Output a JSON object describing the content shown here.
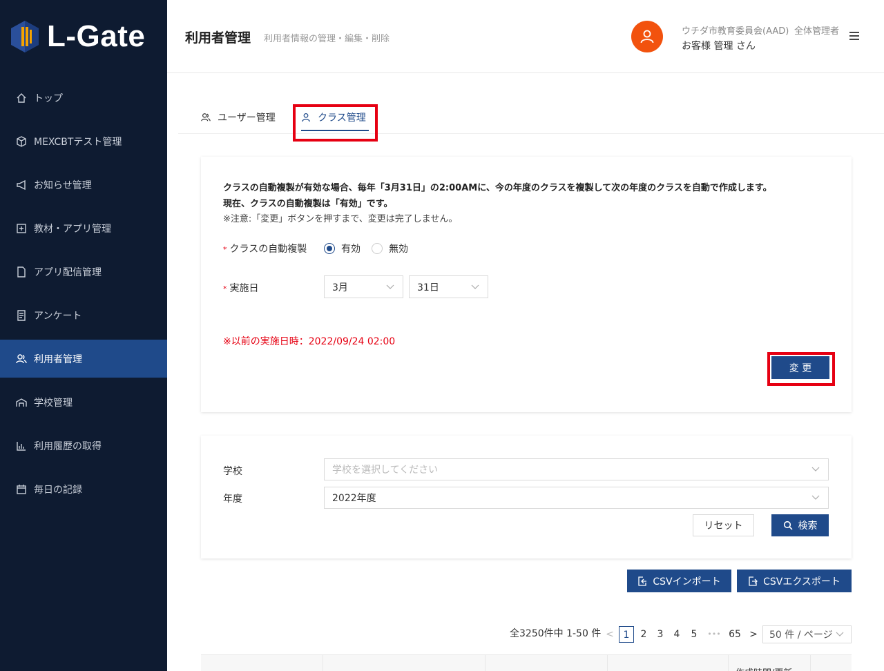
{
  "app": {
    "logo_text": "L-Gate"
  },
  "sidebar": {
    "items": [
      {
        "label": "トップ",
        "icon": "home-icon"
      },
      {
        "label": "MEXCBTテスト管理",
        "icon": "cube-icon"
      },
      {
        "label": "お知らせ管理",
        "icon": "megaphone-icon"
      },
      {
        "label": "教材・アプリ管理",
        "icon": "plus-square-icon"
      },
      {
        "label": "アプリ配信管理",
        "icon": "file-icon"
      },
      {
        "label": "アンケート",
        "icon": "survey-icon"
      },
      {
        "label": "利用者管理",
        "icon": "users-icon",
        "active": true
      },
      {
        "label": "学校管理",
        "icon": "school-icon"
      },
      {
        "label": "利用履歴の取得",
        "icon": "bar-chart-icon"
      },
      {
        "label": "毎日の記録",
        "icon": "calendar-icon"
      }
    ]
  },
  "header": {
    "title": "利用者管理",
    "subtitle": "利用者情報の管理・編集・削除",
    "org": "ウチダ市教育委員会(AAD)",
    "role": "全体管理者",
    "user": "お客様 管理 さん"
  },
  "tabs": [
    {
      "label": "ユーザー管理",
      "icon": "users-icon"
    },
    {
      "label": "クラス管理",
      "icon": "user-icon",
      "active": true
    }
  ],
  "auto_copy": {
    "info_line1": "クラスの自動複製が有効な場合、毎年「3月31日」の2:00AMに、今の年度のクラスを複製して次の年度のクラスを自動で作成します。",
    "info_line2": "現在、クラスの自動複製は「有効」です。",
    "info_line3": "※注意:「変更」ボタンを押すまで、変更は完了しません。",
    "required_mark": "*",
    "label_auto": "クラスの自動複製",
    "option_on": "有効",
    "option_off": "無効",
    "selected": "有効",
    "label_date": "実施日",
    "month": "3月",
    "day": "31日",
    "previous": "※以前の実施日時：2022/09/24 02:00",
    "change_button": "変 更"
  },
  "filter": {
    "school_label": "学校",
    "school_placeholder": "学校を選択してください",
    "year_label": "年度",
    "year_value": "2022年度",
    "reset_button": "リセット",
    "search_button": "検索"
  },
  "actions": {
    "csv_import": "CSVインポート",
    "csv_export": "CSVエクスポート"
  },
  "pagination": {
    "summary": "全3250件中 1-50 件",
    "pages": [
      "1",
      "2",
      "3",
      "4",
      "5"
    ],
    "ellipsis": "•••",
    "last": "65",
    "current": "1",
    "page_size": "50 件 / ページ"
  },
  "table": {
    "partial_header": "作成時間/更新"
  },
  "colors": {
    "sidebar_bg": "#0e1b31",
    "active": "#1f4a8a",
    "accent_orange": "#f2520e",
    "highlight_red": "#e60012"
  }
}
